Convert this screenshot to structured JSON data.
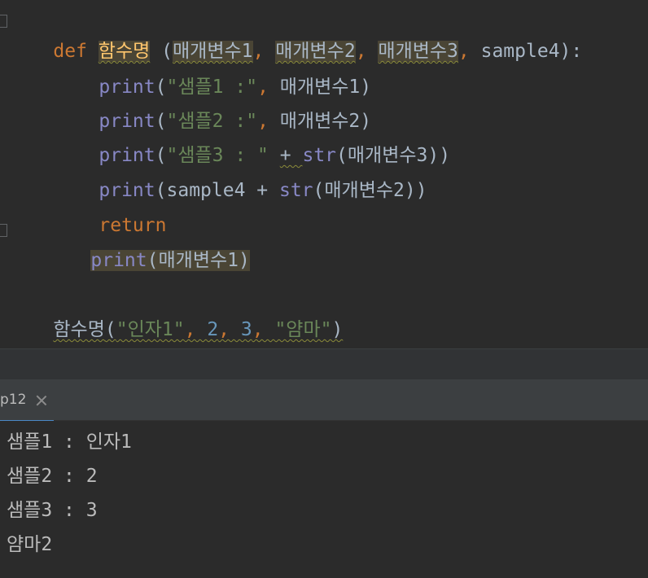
{
  "editor": {
    "def_kw": "def",
    "func_name": "함수명",
    "param1": "매개변수1",
    "param2": "매개변수2",
    "param3": "매개변수3",
    "param4": "sample4",
    "print_kw": "print",
    "str_kw": "str",
    "return_kw": "return",
    "str1": "\"샘플1 :\"",
    "str2": "\"샘플2 :\"",
    "str3": "\"샘플3 : \"",
    "call_arg1": "\"인자1\"",
    "call_arg2": "2",
    "call_arg3": "3",
    "call_arg4": "\"얌마\""
  },
  "console": {
    "tab_label": "p12",
    "output": [
      "샘플1 : 인자1",
      "샘플2 : 2",
      "샘플3 : 3",
      "얌마2"
    ]
  }
}
